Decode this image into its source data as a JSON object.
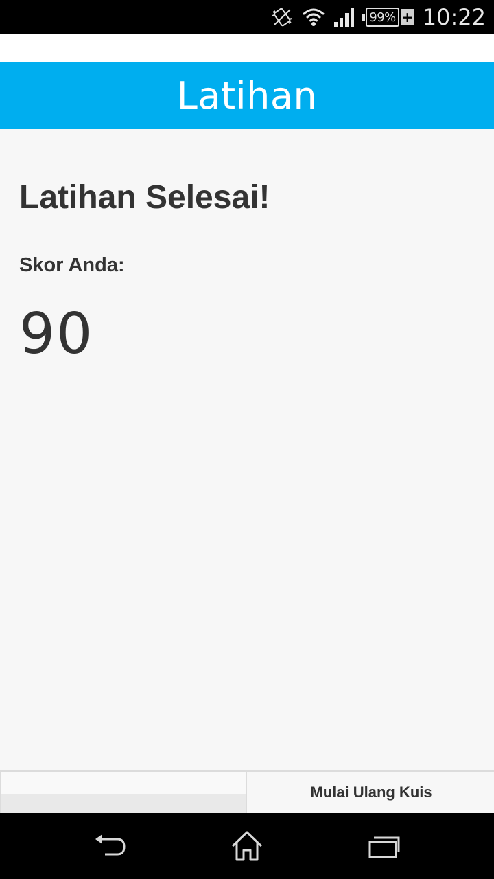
{
  "status_bar": {
    "time": "10:22",
    "battery_percent": "99%",
    "charging_symbol": "+",
    "icons": [
      "vibrate-icon",
      "wifi-icon",
      "signal-icon",
      "battery-icon"
    ]
  },
  "app_header": {
    "title": "Latihan"
  },
  "content": {
    "heading": "Latihan Selesai!",
    "score_label": "Skor Anda:",
    "score_value": "90"
  },
  "bottom_bar": {
    "restart_label": "Mulai Ulang Kuis"
  },
  "nav_bar": {
    "icons": [
      "back-icon",
      "home-icon",
      "recent-apps-icon"
    ]
  },
  "colors": {
    "header_bg": "#00aeef",
    "page_bg": "#f7f7f7",
    "text": "#333333"
  }
}
